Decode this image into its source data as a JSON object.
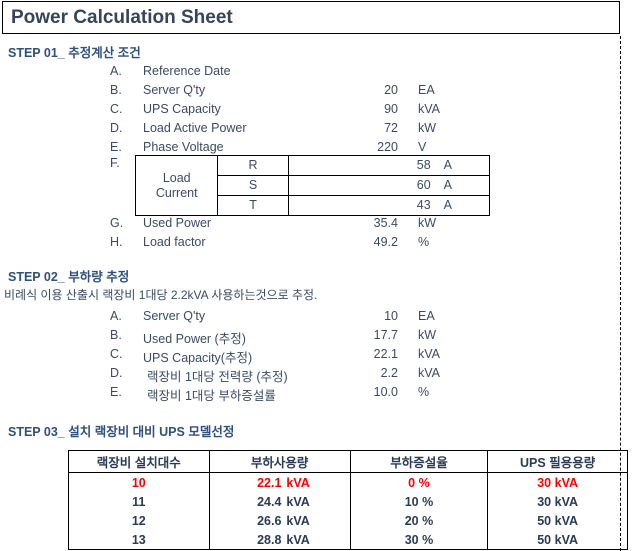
{
  "document": {
    "title": "Power Calculation Sheet"
  },
  "step01": {
    "heading": "STEP 01_ 추정계산 조건",
    "items": [
      {
        "letter": "A.",
        "label": "Reference Date",
        "value": "",
        "unit": ""
      },
      {
        "letter": "B.",
        "label": "Server Q'ty",
        "value": "20",
        "unit": "EA"
      },
      {
        "letter": "C.",
        "label": "UPS Capacity",
        "value": "90",
        "unit": "kVA"
      },
      {
        "letter": "D.",
        "label": "Load Active Power",
        "value": "72",
        "unit": "kW"
      },
      {
        "letter": "E.",
        "label": "Phase Voltage",
        "value": "220",
        "unit": "V"
      }
    ],
    "load_current": {
      "letter": "F.",
      "name": "Load Current",
      "name_line1": "Load",
      "name_line2": "Current",
      "rows": [
        {
          "phase": "R",
          "value": "58",
          "unit": "A"
        },
        {
          "phase": "S",
          "value": "60",
          "unit": "A"
        },
        {
          "phase": "T",
          "value": "43",
          "unit": "A"
        }
      ]
    },
    "items_after": [
      {
        "letter": "G.",
        "label": "Used Power",
        "value": "35.4",
        "unit": "kW"
      },
      {
        "letter": "H.",
        "label": "Load factor",
        "value": "49.2",
        "unit": "%"
      }
    ]
  },
  "step02": {
    "heading": "STEP 02_ 부하량 추정",
    "note": "비례식 이용 산출시 랙장비 1대당 2.2kVA 사용하는것으로 추정.",
    "items": [
      {
        "letter": "A.",
        "label": "Server Q'ty",
        "value": "10",
        "unit": "EA"
      },
      {
        "letter": "B.",
        "label": "Used Power (추정)",
        "value": "17.7",
        "unit": "kW"
      },
      {
        "letter": "C.",
        "label": "UPS Capacity(추정)",
        "value": "22.1",
        "unit": "kVA"
      },
      {
        "letter": "D.",
        "label": "랙장비 1대당 전력량 (추정)",
        "value": "2.2",
        "unit": "kVA"
      },
      {
        "letter": "E.",
        "label": "랙장비 1대당 부하증설률",
        "value": "10.0",
        "unit": "%"
      }
    ]
  },
  "step03": {
    "heading": "STEP 03_ 설치 랙장비 대비 UPS 모델선정",
    "table": {
      "headers": [
        "랙장비 설치대수",
        "부하사용량",
        "부하증설율",
        "UPS 필용용량"
      ],
      "rows": [
        {
          "count": "10",
          "load_num": "22.1",
          "load_unit": "kVA",
          "increase": "0 %",
          "ups": "30 kVA",
          "highlight": true
        },
        {
          "count": "11",
          "load_num": "24.4",
          "load_unit": "kVA",
          "increase": "10 %",
          "ups": "30 kVA",
          "highlight": false
        },
        {
          "count": "12",
          "load_num": "26.6",
          "load_unit": "kVA",
          "increase": "20 %",
          "ups": "50 kVA",
          "highlight": false
        },
        {
          "count": "13",
          "load_num": "28.8",
          "load_unit": "kVA",
          "increase": "30 %",
          "ups": "50 kVA",
          "highlight": false
        }
      ]
    }
  },
  "colors": {
    "heading": "#2f4f7f",
    "title": "#36435a",
    "body": "#3b4a63",
    "highlight": "#ff0000"
  }
}
